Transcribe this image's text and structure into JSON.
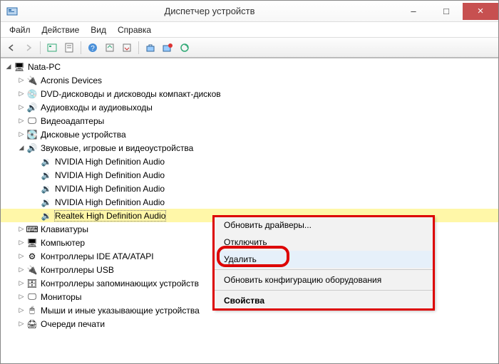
{
  "window": {
    "title": "Диспетчер устройств",
    "minimize": "–",
    "maximize": "□",
    "close": "×"
  },
  "menu": {
    "file": "Файл",
    "action": "Действие",
    "view": "Вид",
    "help": "Справка"
  },
  "tree": {
    "root": "Nata-PC",
    "items": [
      {
        "label": "Acronis Devices",
        "icon": "device",
        "expandable": true
      },
      {
        "label": "DVD-дисководы и дисководы компакт-дисков",
        "icon": "disc",
        "expandable": true
      },
      {
        "label": "Аудиовходы и аудиовыходы",
        "icon": "audio",
        "expandable": true
      },
      {
        "label": "Видеоадаптеры",
        "icon": "display",
        "expandable": true
      },
      {
        "label": "Дисковые устройства",
        "icon": "disk",
        "expandable": true
      },
      {
        "label": "Звуковые, игровые и видеоустройства",
        "icon": "audio",
        "expandable": true,
        "expanded": true,
        "children": [
          {
            "label": "NVIDIA High Definition Audio",
            "icon": "audio-dev"
          },
          {
            "label": "NVIDIA High Definition Audio",
            "icon": "audio-dev"
          },
          {
            "label": "NVIDIA High Definition Audio",
            "icon": "audio-dev"
          },
          {
            "label": "NVIDIA High Definition Audio",
            "icon": "audio-dev"
          },
          {
            "label": "Realtek High Definition Audio",
            "icon": "audio-dev",
            "selected": true
          }
        ]
      },
      {
        "label": "Клавиатуры",
        "icon": "keyboard",
        "expandable": true
      },
      {
        "label": "Компьютер",
        "icon": "computer",
        "expandable": true
      },
      {
        "label": "Контроллеры IDE ATA/ATAPI",
        "icon": "ide",
        "expandable": true
      },
      {
        "label": "Контроллеры USB",
        "icon": "usb",
        "expandable": true
      },
      {
        "label": "Контроллеры запоминающих устройств",
        "icon": "storage",
        "expandable": true
      },
      {
        "label": "Мониторы",
        "icon": "monitor",
        "expandable": true
      },
      {
        "label": "Мыши и иные указывающие устройства",
        "icon": "mouse",
        "expandable": true
      },
      {
        "label": "Очереди печати",
        "icon": "printer",
        "expandable": true
      }
    ]
  },
  "context_menu": {
    "update_drivers": "Обновить драйверы...",
    "disable": "Отключить",
    "delete": "Удалить",
    "scan": "Обновить конфигурацию оборудования",
    "properties": "Свойства"
  },
  "icons": {
    "computer": "🖥",
    "device": "🔌",
    "disc": "💿",
    "audio": "🔊",
    "display": "🖵",
    "disk": "💽",
    "audio-dev": "🔉",
    "keyboard": "⌨",
    "ide": "⚙",
    "usb": "🔌",
    "storage": "🗄",
    "monitor": "🖵",
    "mouse": "🖱",
    "printer": "🖨"
  }
}
